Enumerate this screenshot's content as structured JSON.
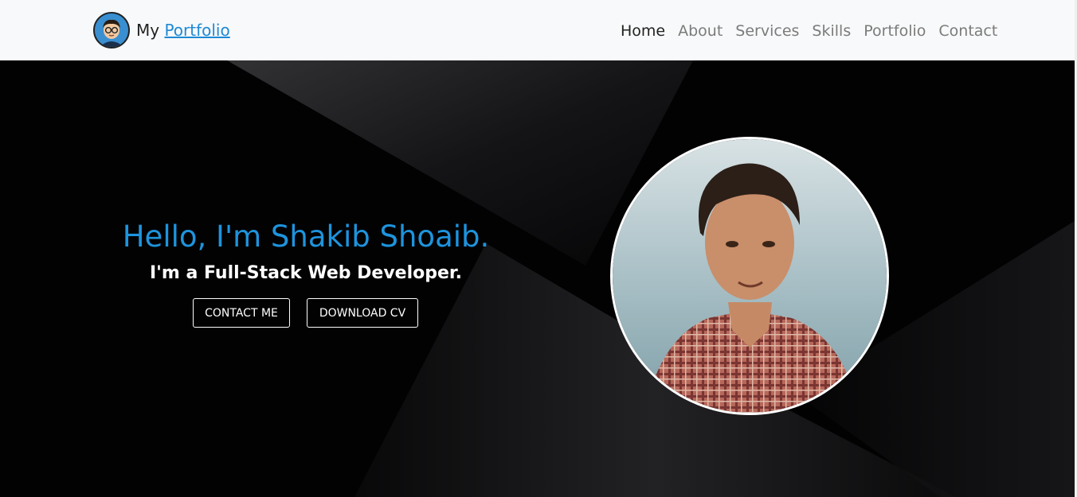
{
  "navbar": {
    "brand_prefix": "My",
    "brand_link": "Portfolio",
    "items": [
      {
        "label": "Home",
        "active": true
      },
      {
        "label": "About"
      },
      {
        "label": "Services"
      },
      {
        "label": "Skills"
      },
      {
        "label": "Portfolio"
      },
      {
        "label": "Contact"
      }
    ]
  },
  "hero": {
    "greeting": "Hello, I'm Shakib Shoaib.",
    "tagline": "I'm a Full-Stack Web Developer.",
    "contact_button": "CONTACT ME",
    "cv_button": "DOWNLOAD CV"
  },
  "colors": {
    "accent": "#1e94dd",
    "navbar_bg": "#f8f9fa",
    "hero_bg": "#020203"
  }
}
